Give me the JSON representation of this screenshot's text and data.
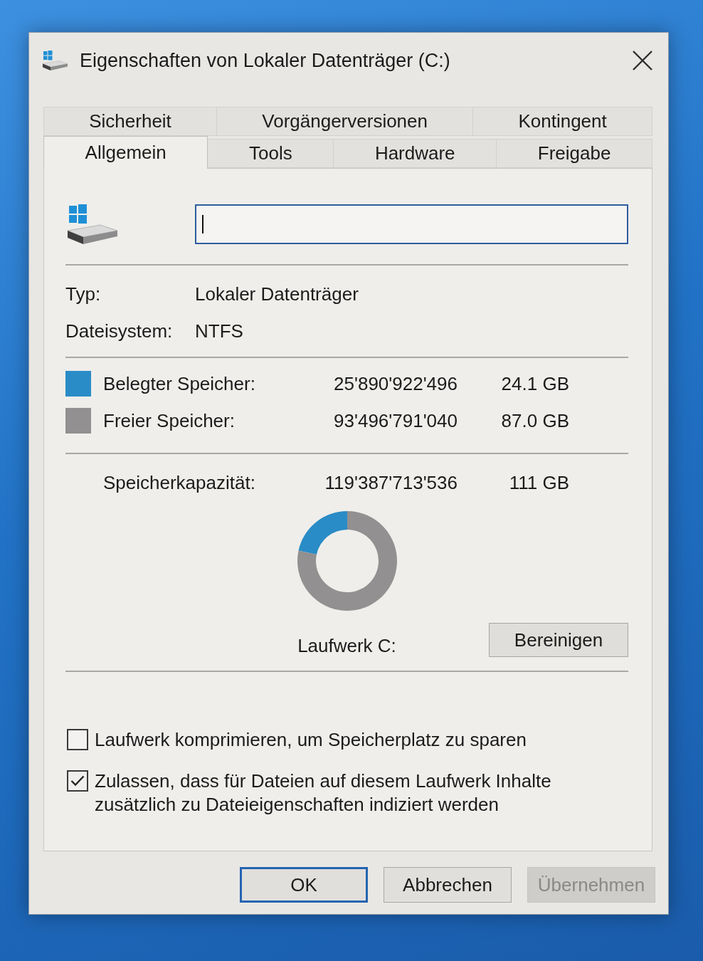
{
  "window": {
    "title": "Eigenschaften von Lokaler Datenträger (C:)"
  },
  "tab_rows": [
    {
      "tabs": [
        {
          "label": "Sicherheit",
          "selected": false
        },
        {
          "label": "Vorgängerversionen",
          "selected": false
        },
        {
          "label": "Kontingent",
          "selected": false
        }
      ]
    },
    {
      "tabs": [
        {
          "label": "Allgemein",
          "selected": true
        },
        {
          "label": "Tools",
          "selected": false
        },
        {
          "label": "Hardware",
          "selected": false
        },
        {
          "label": "Freigabe",
          "selected": false
        }
      ]
    }
  ],
  "drive": {
    "name_field": {
      "focused": true
    }
  },
  "properties": [
    {
      "label": "Typ:",
      "value": "Lokaler Datenträger"
    },
    {
      "label": "Dateisystem:",
      "value": "NTFS"
    }
  ],
  "usage": [
    {
      "label": "Belegter Speicher:",
      "bytes": "25'890'922'496",
      "size": "24.1 GB",
      "color": "#2a8cc6"
    },
    {
      "label": "Freier Speicher:",
      "bytes": "93'496'791'040",
      "size": "87.0 GB",
      "color": "#929090"
    }
  ],
  "capacity": {
    "label": "Speicherkapazität:",
    "bytes": "119'387'713'536",
    "size": "111 GB"
  },
  "drive_chart": {
    "caption": "Laufwerk C:",
    "chart_data": {
      "type": "donut",
      "series": [
        {
          "values": [
            21.7,
            78.3
          ]
        }
      ]
    }
  },
  "cleanup_button": {
    "label": "Bereinigen"
  },
  "options": [
    {
      "label": "Laufwerk komprimieren, um Speicherplatz zu sparen",
      "checked": false
    },
    {
      "label": "Zulassen, dass für Dateien auf diesem Laufwerk Inhalte zusätzlich zu Dateieigenschaften indiziert werden",
      "checked": true
    }
  ],
  "buttons": [
    {
      "label": "OK",
      "default": true,
      "disabled": false
    },
    {
      "label": "Abbrechen",
      "default": false,
      "disabled": false
    },
    {
      "label": "Übernehmen",
      "default": false,
      "disabled": true
    }
  ]
}
